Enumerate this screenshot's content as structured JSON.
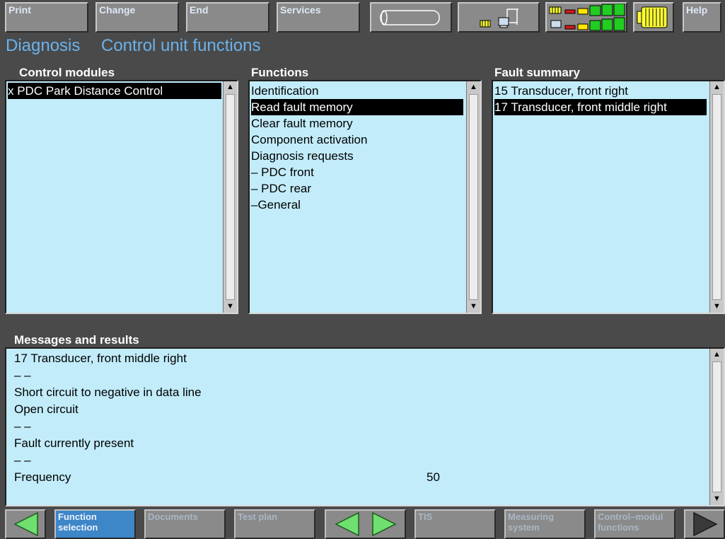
{
  "toolbar": {
    "print": "Print",
    "change": "Change",
    "end": "End",
    "services": "Services",
    "help": "Help"
  },
  "breadcrumb": {
    "part1": "Diagnosis",
    "part2": "Control unit functions"
  },
  "control_modules": {
    "title": "Control modules",
    "items": [
      "x PDC Park Distance Control"
    ]
  },
  "functions": {
    "title": "Functions",
    "items": [
      "Identification",
      "Read fault memory",
      "Clear fault memory",
      "Component activation",
      "Diagnosis requests",
      "– PDC front",
      "– PDC rear",
      "–General"
    ]
  },
  "fault_summary": {
    "title": "Fault summary",
    "items": [
      "15 Transducer, front right",
      "17 Transducer, front middle right"
    ]
  },
  "messages": {
    "title": "Messages and results",
    "lines": [
      "17 Transducer, front middle right",
      "– –",
      "Short circuit to negative in data line",
      "Open circuit",
      "– –",
      "Fault currently present",
      "– –"
    ],
    "frequency_label": "Frequency",
    "frequency_value": "50"
  },
  "bottom": {
    "function_selection": "Function\nselection",
    "documents": "Documents",
    "test_plan": "Test plan",
    "tis": "TIS",
    "measuring_system": "Measuring\nsystem",
    "control_module_functions": "Control–modul\nfunctions"
  },
  "colors": {
    "background": "#4a4a4a",
    "panel": "#c2ecfa",
    "title": "#6ab2ec",
    "selection": "#000000",
    "nav_arrow": "#6fe070"
  },
  "icons": [
    "cylinder-icon",
    "network-icon",
    "status-bars-icon",
    "connector-icon",
    "nav-left-icon",
    "nav-right-icon"
  ]
}
